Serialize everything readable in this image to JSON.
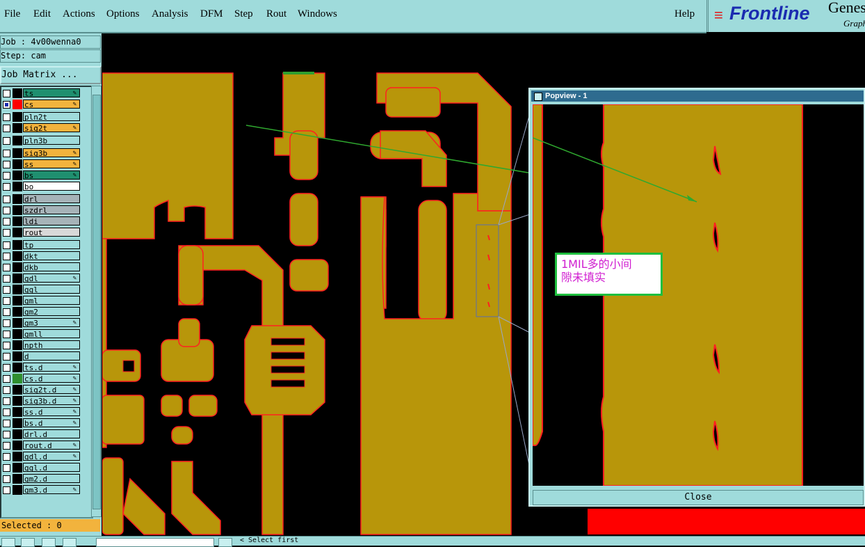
{
  "menu": [
    "File",
    "Edit",
    "Actions",
    "Options",
    "Analysis",
    "DFM",
    "Step",
    "Rout",
    "Windows"
  ],
  "help": "Help",
  "logo": {
    "brand": "Frontline",
    "product": "Genes",
    "sub": "Graphi"
  },
  "job": {
    "job_line": "Job : 4v00wenna0",
    "step_line": "Step: cam",
    "matrix_button": "Job Matrix ..."
  },
  "layers": [
    {
      "name": "ts",
      "color": "#1f8f6f",
      "sel": false,
      "aff": true
    },
    {
      "name": "cs",
      "color": "#f2b33d",
      "sel": true,
      "aff": true
    },
    {
      "name": "pln2t",
      "color": "#9fdbdb",
      "sel": false,
      "aff": false
    },
    {
      "name": "sig2t",
      "color": "#f2b33d",
      "sel": false,
      "aff": true
    },
    {
      "name": "pln3b",
      "color": "#9fdbdb",
      "sel": false,
      "aff": false
    },
    {
      "name": "sig3b",
      "color": "#f2b33d",
      "sel": false,
      "aff": true
    },
    {
      "name": "ss",
      "color": "#f2b33d",
      "sel": false,
      "aff": true
    },
    {
      "name": "bs",
      "color": "#1f8f6f",
      "sel": false,
      "aff": true
    },
    {
      "name": "bo",
      "color": "#ffffff",
      "sel": false,
      "aff": false
    },
    {
      "name": "drl",
      "color": "#a6b3b8",
      "sel": false,
      "aff": false
    },
    {
      "name": "szdrl",
      "color": "#a6b3b8",
      "sel": false,
      "aff": false
    },
    {
      "name": "ldi",
      "color": "#a6b3b8",
      "sel": false,
      "aff": false
    },
    {
      "name": "rout",
      "color": "#d8d8d8",
      "sel": false,
      "aff": false
    },
    {
      "name": "tp",
      "color": "#9fdbdb",
      "sel": false,
      "aff": false
    },
    {
      "name": "dkt",
      "color": "#9fdbdb",
      "sel": false,
      "aff": false
    },
    {
      "name": "dkb",
      "color": "#9fdbdb",
      "sel": false,
      "aff": false
    },
    {
      "name": "gdl",
      "color": "#9fdbdb",
      "sel": false,
      "aff": true
    },
    {
      "name": "ggl",
      "color": "#9fdbdb",
      "sel": false,
      "aff": false
    },
    {
      "name": "gml",
      "color": "#9fdbdb",
      "sel": false,
      "aff": false
    },
    {
      "name": "gm2",
      "color": "#9fdbdb",
      "sel": false,
      "aff": false
    },
    {
      "name": "gm3",
      "color": "#9fdbdb",
      "sel": false,
      "aff": true
    },
    {
      "name": "gmll",
      "color": "#9fdbdb",
      "sel": false,
      "aff": false
    },
    {
      "name": "npth",
      "color": "#9fdbdb",
      "sel": false,
      "aff": false
    },
    {
      "name": "d",
      "color": "#9fdbdb",
      "sel": false,
      "aff": false
    },
    {
      "name": "ts.d",
      "color": "#9fdbdb",
      "sel": false,
      "aff": true
    },
    {
      "name": "cs.d",
      "color": "#9fdbdb",
      "sel": false,
      "aff": true
    },
    {
      "name": "sig2t.d",
      "color": "#9fdbdb",
      "sel": false,
      "aff": true
    },
    {
      "name": "sig3b.d",
      "color": "#9fdbdb",
      "sel": false,
      "aff": true
    },
    {
      "name": "ss.d",
      "color": "#9fdbdb",
      "sel": false,
      "aff": true
    },
    {
      "name": "bs.d",
      "color": "#9fdbdb",
      "sel": false,
      "aff": true
    },
    {
      "name": "drl.d",
      "color": "#9fdbdb",
      "sel": false,
      "aff": false
    },
    {
      "name": "rout.d",
      "color": "#9fdbdb",
      "sel": false,
      "aff": true
    },
    {
      "name": "gdl.d",
      "color": "#9fdbdb",
      "sel": false,
      "aff": true
    },
    {
      "name": "ggl.d",
      "color": "#9fdbdb",
      "sel": false,
      "aff": false
    },
    {
      "name": "gm2.d",
      "color": "#9fdbdb",
      "sel": false,
      "aff": false
    },
    {
      "name": "gm3.d",
      "color": "#9fdbdb",
      "sel": false,
      "aff": true
    }
  ],
  "selected": "Selected : 0",
  "popview": {
    "title": "Popview - 1",
    "close": "Close"
  },
  "annotation": {
    "line1": "1MIL多的小间",
    "line2": "隙未填实"
  },
  "status": "< Select first",
  "colors": {
    "copper": "#b8960a",
    "outline": "#ff2020",
    "panel": "#9fdbdb",
    "note_border": "#1fbf3f",
    "note_text": "#d01ed0"
  }
}
